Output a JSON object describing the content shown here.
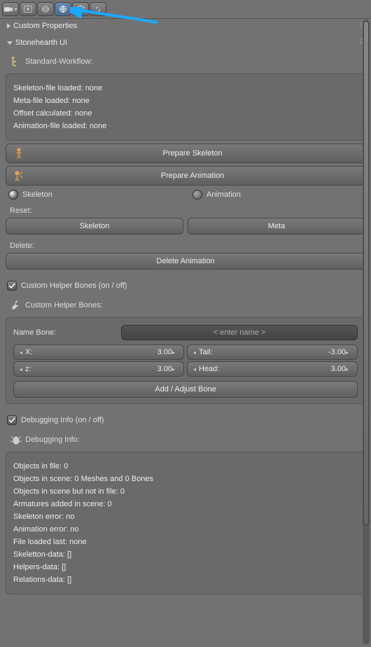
{
  "panels": {
    "custom_props": {
      "title": "Custom Properties"
    },
    "stonehearth": {
      "title": "Stonehearth UI"
    }
  },
  "workflow": {
    "header": "Standard-Workflow:",
    "skeleton_file": "Skeleton-file loaded: none",
    "meta_file": "Meta-file loaded: none",
    "offset_calc": "Offset calculated: none",
    "anim_file": "Animation-file loaded: none",
    "prepare_skeleton": "Prepare Skeleton",
    "prepare_animation": "Prepare Animation",
    "radio_skeleton": "Skeleton",
    "radio_animation": "Animation"
  },
  "reset": {
    "label": "Reset:",
    "skeleton_btn": "Skeleton",
    "meta_btn": "Meta"
  },
  "delete": {
    "label": "Delete:",
    "delete_anim_btn": "Delete Animation"
  },
  "helper": {
    "toggle_label": "Custom Helper Bones (on / off)",
    "section_label": "Custom Helper Bones:",
    "name_label": "Name Bone:",
    "name_placeholder": "< enter name >",
    "x_label": "X:",
    "x_val": "3.00",
    "z_label": "z:",
    "z_val": "3.00",
    "tail_label": "Tail:",
    "tail_val": "-3.00",
    "head_label": "Head:",
    "head_val": "3.00",
    "add_btn": "Add / Adjust Bone"
  },
  "debug": {
    "toggle_label": "Debugging Info (on / off)",
    "section_label": "Debugging Info:",
    "lines": [
      "Objects in file: 0",
      "Objects in scene: 0 Meshes and 0 Bones",
      "Objects in scene but not in file: 0",
      "Armatures added in scene: 0",
      "Skeleton error: no",
      "Animation error: no",
      "File loaded last: none",
      "Skeletton-data: []",
      "Helpers-data: []",
      "Relations-data: []"
    ]
  }
}
